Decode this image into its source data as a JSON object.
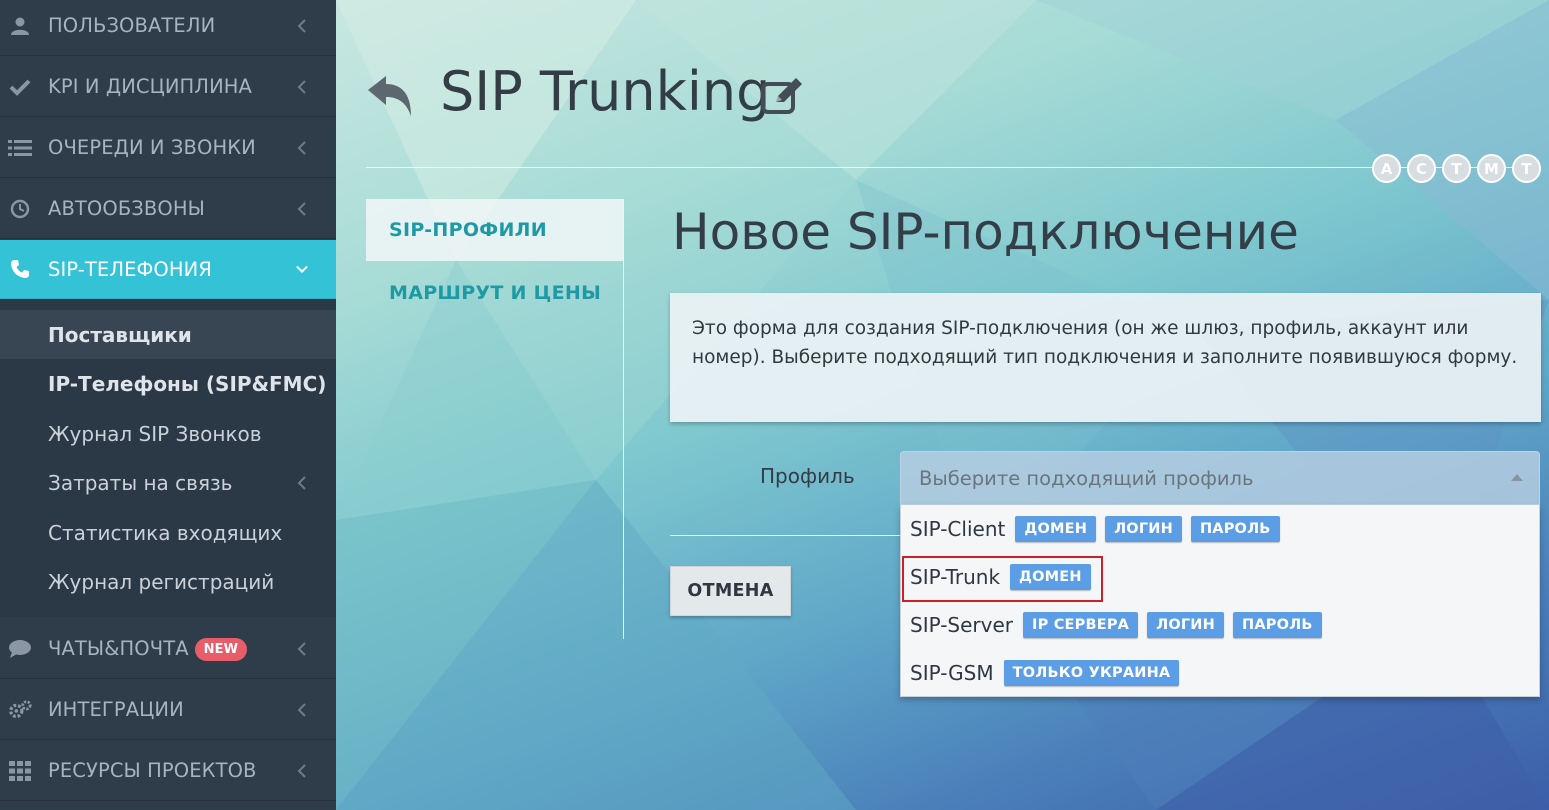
{
  "sidebar": {
    "items": [
      {
        "label": "ПОЛЬЗОВАТЕЛИ",
        "icon": "user-icon"
      },
      {
        "label": "KPI И ДИСЦИПЛИНА",
        "icon": "check-icon"
      },
      {
        "label": "ОЧЕРЕДИ И ЗВОНКИ",
        "icon": "list-icon"
      },
      {
        "label": "АВТООБЗВОНЫ",
        "icon": "clock-icon"
      },
      {
        "label": "SIP-ТЕЛЕФОНИЯ",
        "icon": "phone-icon"
      },
      {
        "label": "ЧАТЫ&ПОЧТА",
        "icon": "chat-icon",
        "badge": "NEW"
      },
      {
        "label": "ИНТЕГРАЦИИ",
        "icon": "gears-icon"
      },
      {
        "label": "РЕСУРСЫ ПРОЕКТОВ",
        "icon": "grid-icon"
      }
    ],
    "submenu": [
      {
        "label": "Поставщики"
      },
      {
        "label": "IP-Телефоны (SIP&FMC)"
      },
      {
        "label": "Журнал SIP Звонков"
      },
      {
        "label": "Затраты на связь"
      },
      {
        "label": "Статистика входящих"
      },
      {
        "label": "Журнал регистраций"
      }
    ]
  },
  "header": {
    "title": "SIP Trunking",
    "circles": [
      "A",
      "C",
      "T",
      "M",
      "T"
    ]
  },
  "tabs": [
    {
      "label": "SIP-ПРОФИЛИ"
    },
    {
      "label": "МАРШРУТ И ЦЕНЫ"
    }
  ],
  "form": {
    "title": "Новое SIP-подключение",
    "info": "Это форма для создания SIP-подключения (он же шлюз, профиль, аккаунт или номер). Выберите подходящий тип подключения и заполните появившуюся форму.",
    "profile_label": "Профиль",
    "select_placeholder": "Выберите подходящий профиль",
    "cancel_label": "ОТМЕНА",
    "options": [
      {
        "name": "SIP-Client",
        "tags": [
          "ДОМЕН",
          "ЛОГИН",
          "ПАРОЛЬ"
        ]
      },
      {
        "name": "SIP-Trunk",
        "tags": [
          "ДОМЕН"
        ]
      },
      {
        "name": "SIP-Server",
        "tags": [
          "IP СЕРВЕРА",
          "ЛОГИН",
          "ПАРОЛЬ"
        ]
      },
      {
        "name": "SIP-GSM",
        "tags": [
          "ТОЛЬКО УКРАИНА"
        ]
      }
    ]
  },
  "colors": {
    "accent": "#34c3d6",
    "tab_text": "#1f9aa5",
    "tag_bg": "#5b9ee6",
    "badge_bg": "#e85d6a",
    "highlight": "#cc1f28"
  }
}
